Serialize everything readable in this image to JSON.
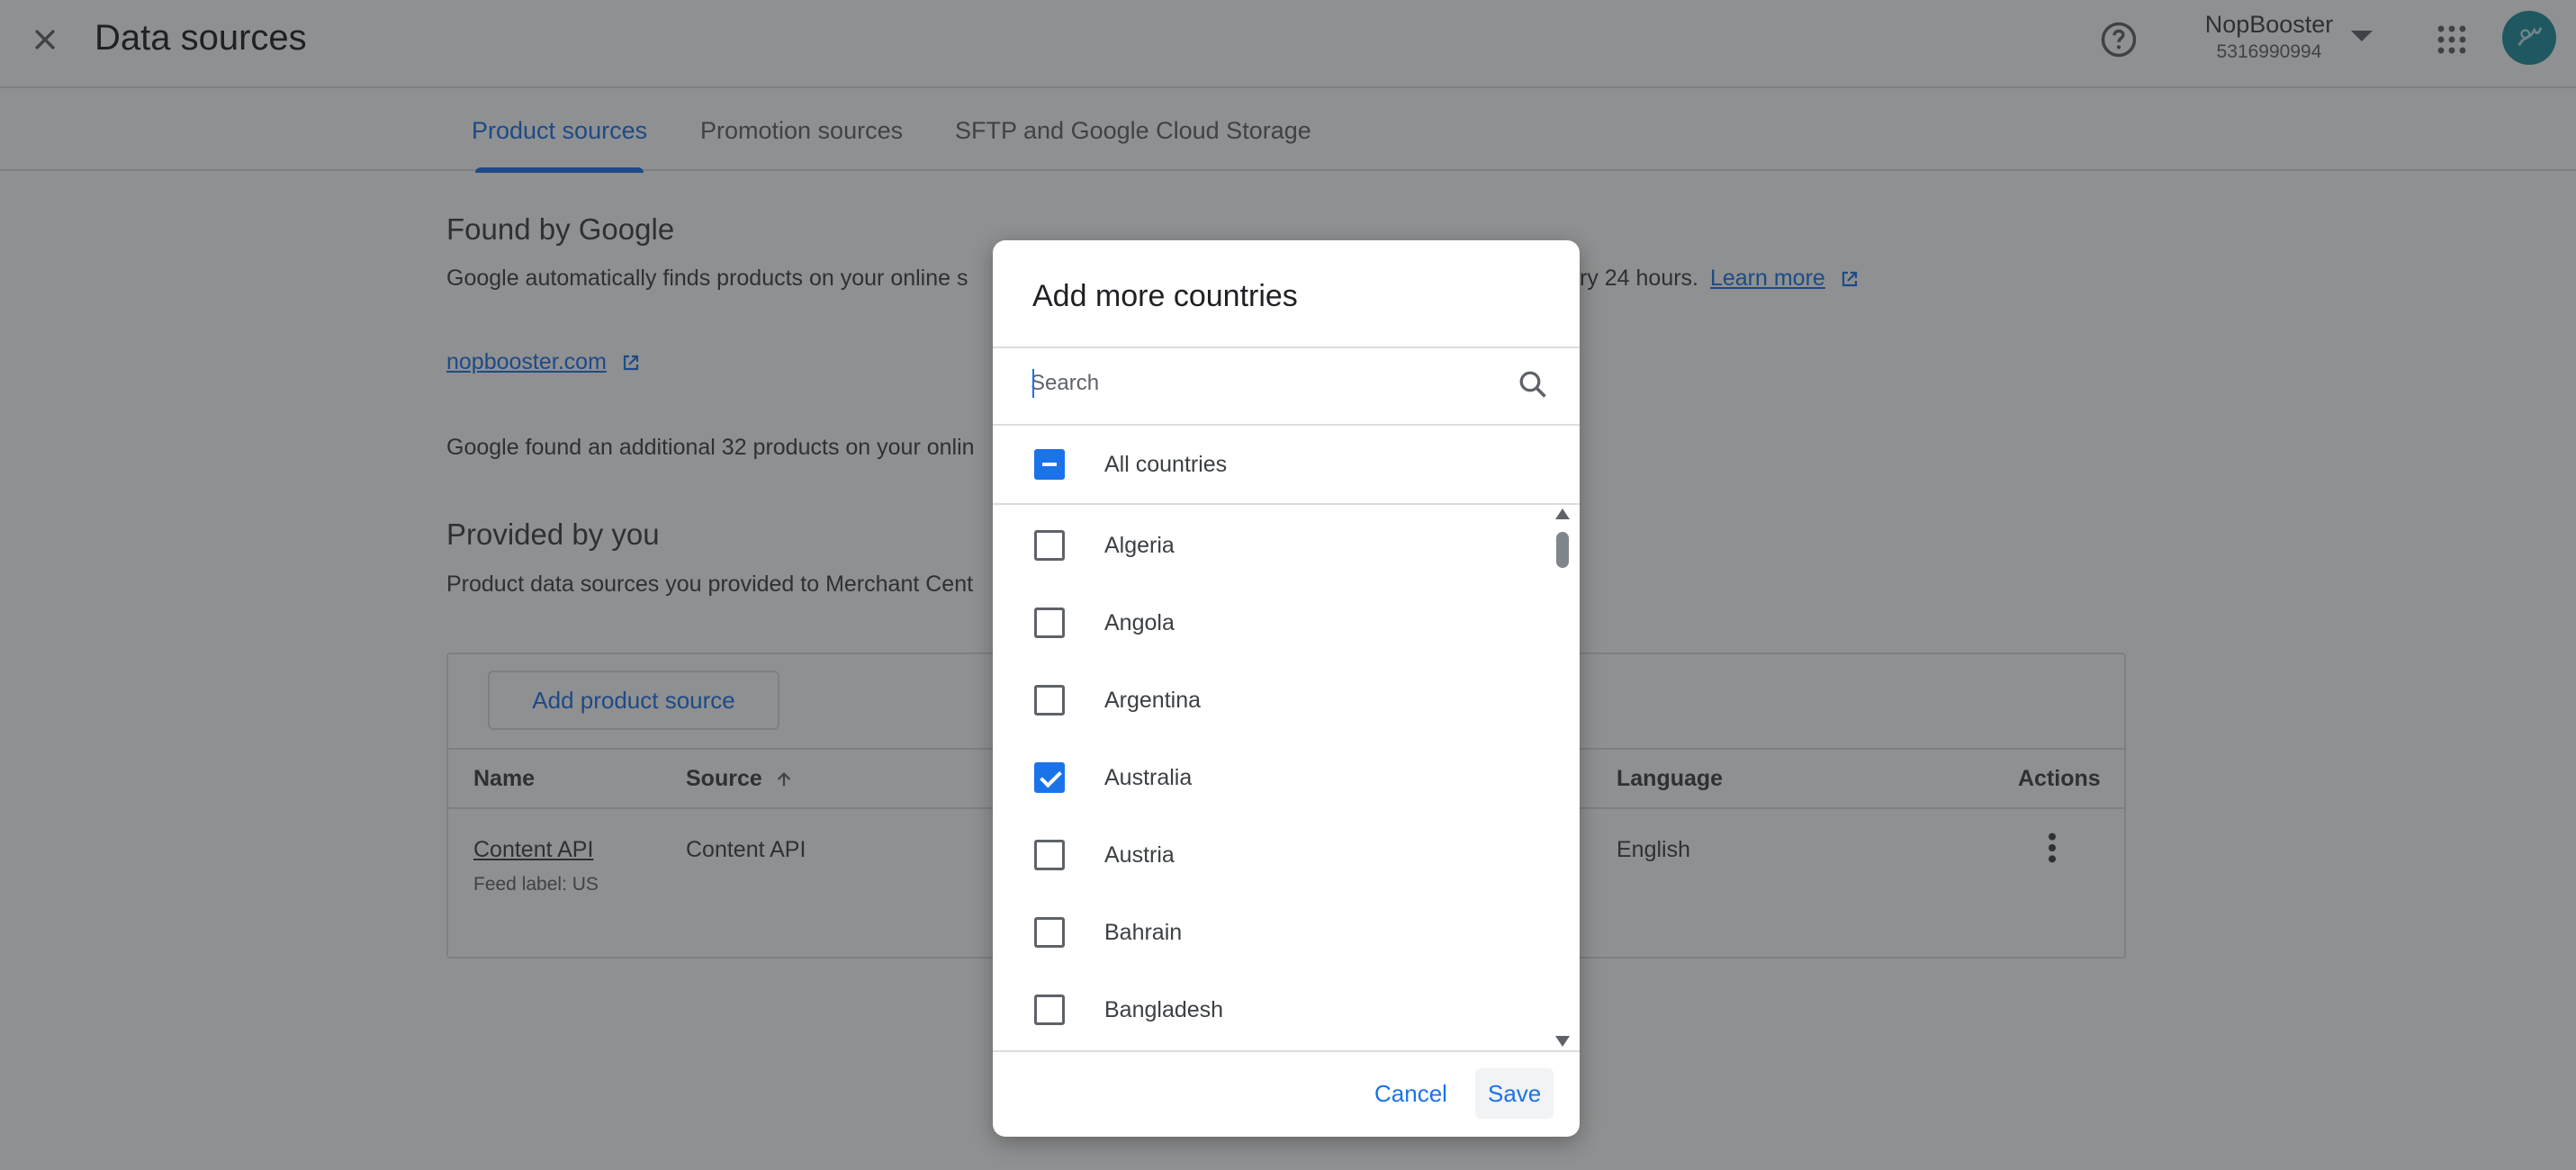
{
  "header": {
    "title": "Data sources",
    "account_name": "NopBooster",
    "account_id": "5316990994"
  },
  "tabs": [
    {
      "label": "Product sources",
      "active": true
    },
    {
      "label": "Promotion sources",
      "active": false
    },
    {
      "label": "SFTP and Google Cloud Storage",
      "active": false
    }
  ],
  "found_by_google": {
    "title": "Found by Google",
    "description": "Google automatically finds products on your online s",
    "description_tail": "ry 24 hours.",
    "learn_more": "Learn more",
    "site_link": "nopbooster.com",
    "additional_text": "Google found an additional 32 products on your onlin"
  },
  "provided_by_you": {
    "title": "Provided by you",
    "description": "Product data sources you provided to Merchant Cent",
    "add_button": "Add product source"
  },
  "table": {
    "columns": {
      "name": "Name",
      "source": "Source",
      "language": "Language",
      "actions": "Actions"
    },
    "rows": [
      {
        "name": "Content API",
        "feed_label": "Feed label: US",
        "source": "Content API",
        "language": "English"
      }
    ]
  },
  "dialog": {
    "title": "Add more countries",
    "search_placeholder": "Search",
    "all_countries": {
      "label": "All countries",
      "state": "indeterminate"
    },
    "countries": [
      {
        "label": "Algeria",
        "checked": false
      },
      {
        "label": "Angola",
        "checked": false
      },
      {
        "label": "Argentina",
        "checked": false
      },
      {
        "label": "Australia",
        "checked": true
      },
      {
        "label": "Austria",
        "checked": false
      },
      {
        "label": "Bahrain",
        "checked": false
      },
      {
        "label": "Bangladesh",
        "checked": false
      }
    ],
    "cancel_label": "Cancel",
    "save_label": "Save"
  },
  "colors": {
    "accent": "#1a73e8",
    "avatar": "#1e8e9e",
    "scrim": "rgba(32,33,36,0.5)"
  },
  "icons": [
    "close-icon",
    "help-icon",
    "chevron-down-icon",
    "apps-grid-icon",
    "avatar",
    "external-link-icon",
    "arrow-up-icon",
    "more-vert-icon",
    "search-icon"
  ]
}
